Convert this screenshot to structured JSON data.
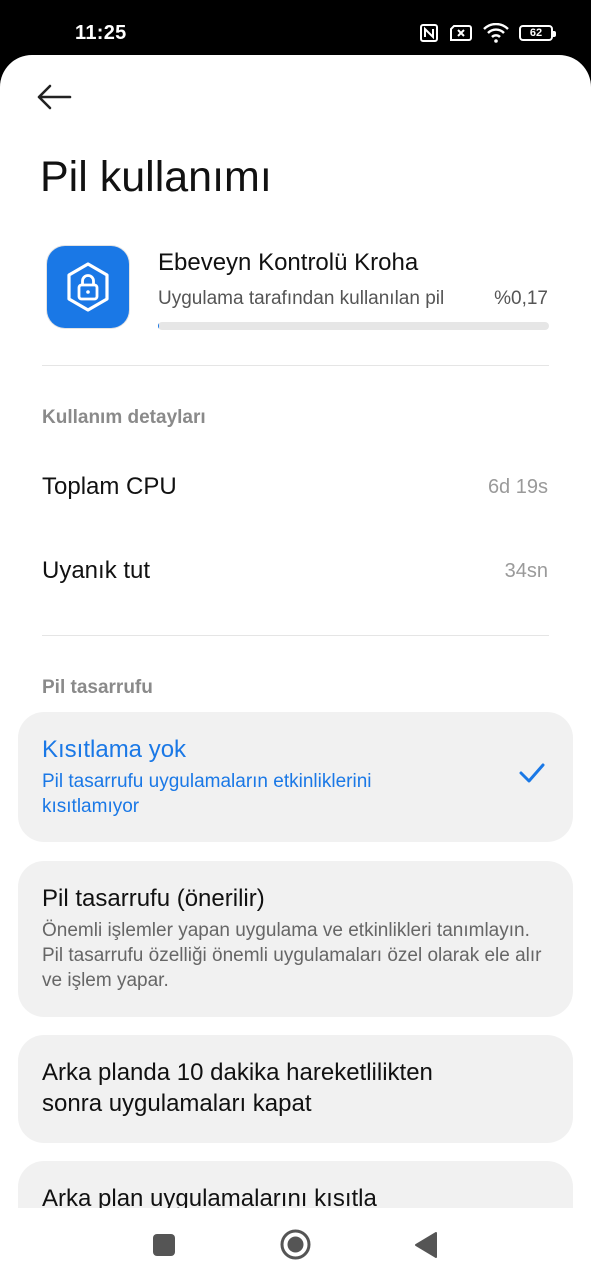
{
  "status_bar": {
    "time": "11:25",
    "battery": "62",
    "icons": [
      "nfc-icon",
      "no-sim-icon",
      "wifi-icon",
      "battery-icon"
    ]
  },
  "header": {
    "back_icon": "arrow-left-icon",
    "title": "Pil kullanımı"
  },
  "app": {
    "name": "Ebeveyn Kontrolü Kroha",
    "icon": "shield-lock-icon",
    "usage_label": "Uygulama tarafından kullanılan pil",
    "usage_value": "%0,17",
    "usage_fraction": 0.0017
  },
  "usage_details": {
    "heading": "Kullanım detayları",
    "rows": [
      {
        "label": "Toplam CPU",
        "value": "6d 19s"
      },
      {
        "label": "Uyanık tut",
        "value": "34sn"
      }
    ]
  },
  "battery_saver": {
    "heading": "Pil tasarrufu",
    "options": [
      {
        "title": "Kısıtlama yok",
        "desc": "Pil tasarrufu uygulamaların etkinliklerini kısıtlamıyor",
        "selected": true
      },
      {
        "title": "Pil tasarrufu (önerilir)",
        "desc": "Önemli işlemler yapan uygulama ve etkinlikleri tanımlayın. Pil tasarrufu özelliği önemli uygulamaları özel olarak ele alır ve işlem yapar.",
        "selected": false
      },
      {
        "title": "Arka planda 10 dakika hareketlilikten sonra uygulamaları kapat",
        "desc": "",
        "selected": false
      },
      {
        "title": "Arka plan uygulamalarını kısıtla",
        "desc": "",
        "selected": false
      }
    ]
  },
  "colors": {
    "accent": "#1a78e6",
    "card_bg": "#f1f1f1"
  },
  "nav_bar": {
    "icons": [
      "recents-square-icon",
      "home-circle-icon",
      "back-triangle-icon"
    ]
  }
}
